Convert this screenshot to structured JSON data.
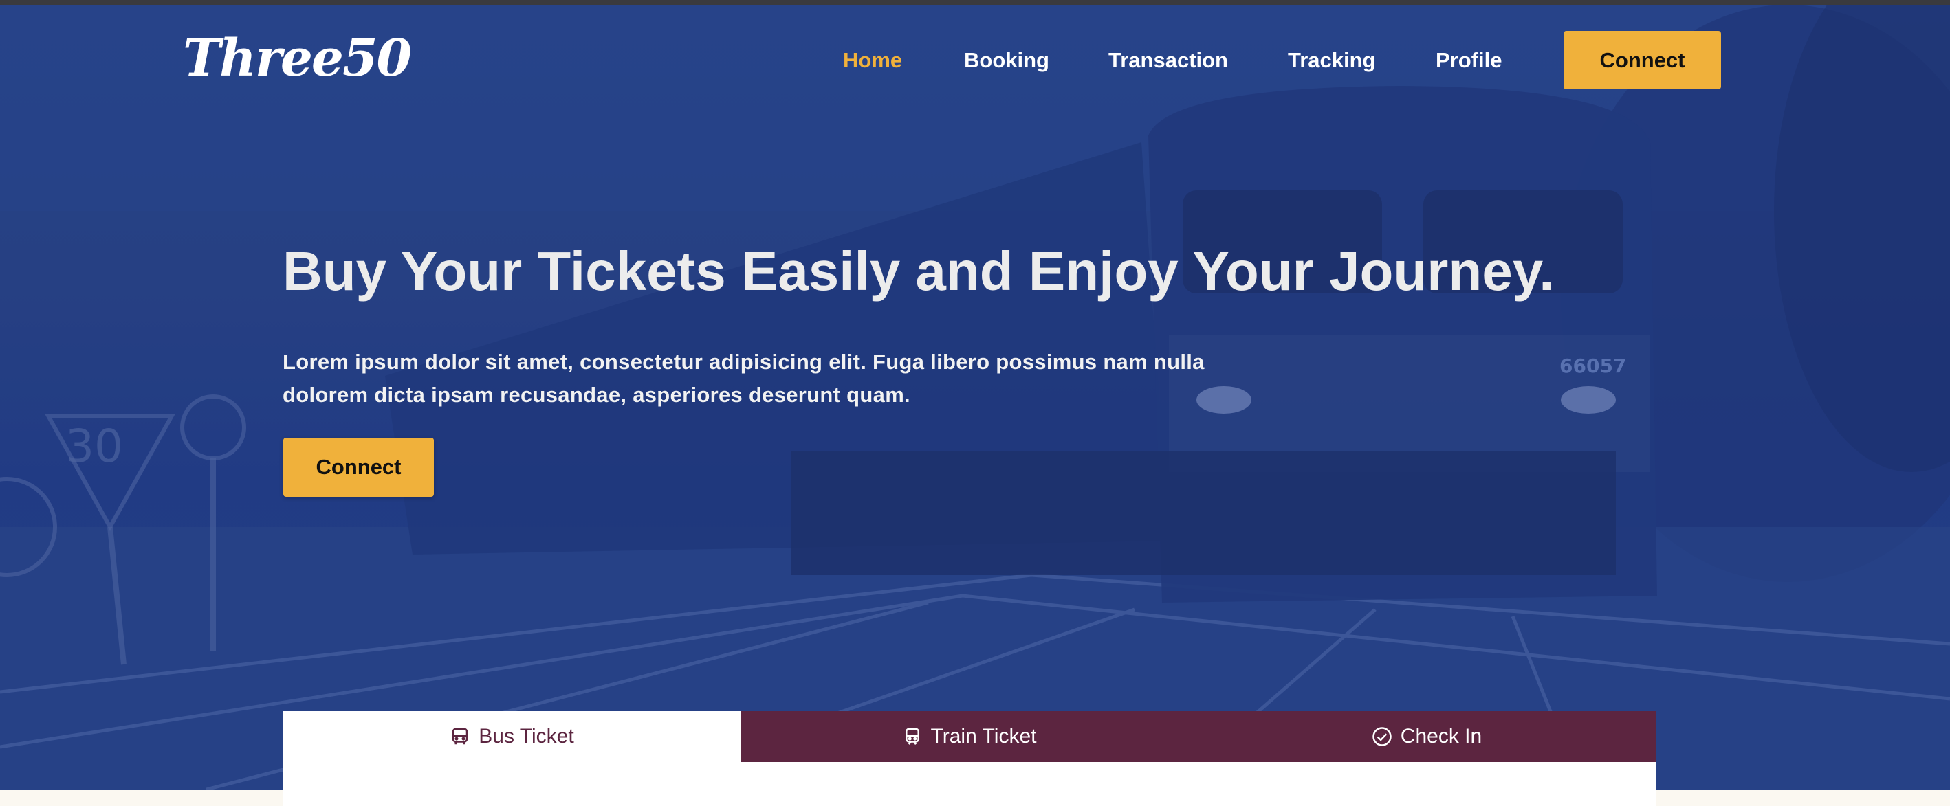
{
  "brand": {
    "logo_text": "Three50"
  },
  "nav": {
    "items": [
      {
        "label": "Home",
        "active": true
      },
      {
        "label": "Booking"
      },
      {
        "label": "Transaction"
      },
      {
        "label": "Tracking"
      },
      {
        "label": "Profile"
      }
    ],
    "cta_label": "Connect"
  },
  "hero": {
    "headline": "Buy Your Tickets Easily and Enjoy Your Journey.",
    "description": "Lorem ipsum dolor sit amet, consectetur adipisicing elit. Fuga libero possimus nam nulla dolorem dicta ipsam recusandae, asperiores deserunt quam.",
    "cta_label": "Connect",
    "background_icon": "train-photo",
    "sign_text": "30",
    "locomotive_number": "66057"
  },
  "booking_tabs": [
    {
      "label": "Bus Ticket",
      "icon": "bus-icon",
      "active": true
    },
    {
      "label": "Train Ticket",
      "icon": "train-icon"
    },
    {
      "label": "Check In",
      "icon": "check-circle-icon"
    }
  ],
  "colors": {
    "accent": "#f0b13b",
    "hero_overlay": "#24407f",
    "tab_bg": "#5c2540",
    "page_bg": "#fbf8f1"
  }
}
